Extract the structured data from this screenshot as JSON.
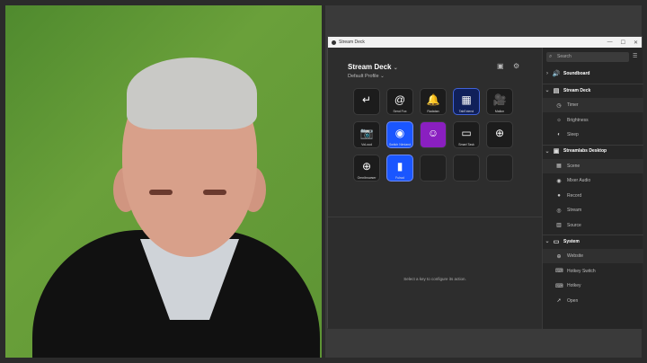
{
  "window": {
    "title": "Stream Deck",
    "controls": [
      "—",
      "☐",
      "✕"
    ]
  },
  "profile": {
    "name": "Stream Deck",
    "subtitle": "Default Profile"
  },
  "keys": [
    {
      "glyph": "↵",
      "label": "",
      "style": "plain"
    },
    {
      "glyph": "@",
      "label": "Send Fox",
      "style": "plain"
    },
    {
      "glyph": "🔔",
      "label": "Radatan",
      "style": "plain"
    },
    {
      "glyph": "▦",
      "label": "TabExtend",
      "style": "navy"
    },
    {
      "glyph": "🎥",
      "label": "Mailon",
      "style": "plain"
    },
    {
      "glyph": "📷",
      "label": "VoLoud",
      "style": "plain"
    },
    {
      "glyph": "◉",
      "label": "Switch Nimiand",
      "style": "blue"
    },
    {
      "glyph": "☺",
      "label": "",
      "style": "purple"
    },
    {
      "glyph": "▭",
      "label": "Smart Task",
      "style": "plain"
    },
    {
      "glyph": "⊕",
      "label": "",
      "style": "plain"
    },
    {
      "glyph": "⊕",
      "label": "Omnibrowser",
      "style": "plain"
    },
    {
      "glyph": "▮",
      "label": "Fulrad",
      "style": "blue"
    },
    {
      "glyph": "",
      "label": "",
      "style": "empty"
    },
    {
      "glyph": "",
      "label": "",
      "style": "empty"
    },
    {
      "glyph": "",
      "label": "",
      "style": "empty"
    }
  ],
  "hint": "Select a key to configure its action.",
  "sidebar": {
    "search_placeholder": "Search",
    "categories": [
      {
        "name": "Soundboard",
        "icon": "speaker-icon",
        "items": []
      },
      {
        "name": "Stream Deck",
        "icon": "streamdeck-icon",
        "items": [
          {
            "label": "Timer",
            "icon": "timer-icon"
          },
          {
            "label": "Brightness",
            "icon": "brightness-icon"
          },
          {
            "label": "Sleep",
            "icon": "sleep-icon"
          }
        ]
      },
      {
        "name": "Streamlabs Desktop",
        "icon": "streamlabs-icon",
        "items": [
          {
            "label": "Scene",
            "icon": "scene-icon"
          },
          {
            "label": "Mixer Audio",
            "icon": "mixer-icon"
          },
          {
            "label": "Record",
            "icon": "record-icon"
          },
          {
            "label": "Stream",
            "icon": "stream-icon"
          },
          {
            "label": "Source",
            "icon": "source-icon"
          }
        ]
      },
      {
        "name": "System",
        "icon": "system-icon",
        "items": [
          {
            "label": "Website",
            "icon": "globe-icon"
          },
          {
            "label": "Hotkey Switch",
            "icon": "hotkey-switch-icon"
          },
          {
            "label": "Hotkey",
            "icon": "keyboard-icon"
          },
          {
            "label": "Open",
            "icon": "rocket-icon"
          }
        ]
      }
    ]
  }
}
